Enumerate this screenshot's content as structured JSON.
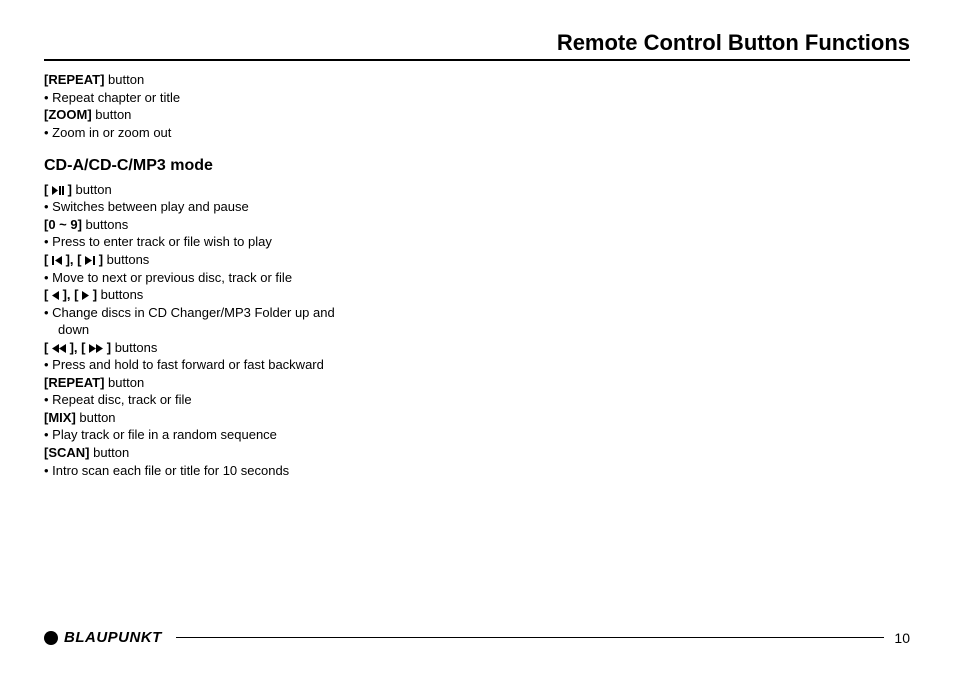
{
  "page_title": "Remote Control Button Functions",
  "top_items": [
    {
      "label_pre": "[",
      "label_main": "REPEAT",
      "label_post": "]",
      "suffix": " button",
      "bullets": [
        "Repeat chapter or title"
      ]
    },
    {
      "label_pre": "[",
      "label_main": "ZOOM",
      "label_post": "]",
      "suffix": " button",
      "bullets": [
        "Zoom in or zoom out"
      ]
    }
  ],
  "subheading": "CD-A/CD-C/MP3 mode",
  "mode_items": [
    {
      "type": "icons",
      "icon_set": "playpause",
      "suffix": " button",
      "bullets": [
        "Switches between play and pause"
      ]
    },
    {
      "type": "text",
      "label_pre": "",
      "label_main": "[0 ~ 9]",
      "label_post": "",
      "suffix": " buttons",
      "bullets": [
        "Press to enter track or file wish to play"
      ]
    },
    {
      "type": "icons",
      "icon_set": "prevnext",
      "suffix": " buttons",
      "bullets": [
        "Move to next or previous disc, track or file"
      ]
    },
    {
      "type": "icons",
      "icon_set": "leftright",
      "suffix": " buttons",
      "bullets": [
        "Change discs in CD Changer/MP3 Folder up and",
        "down"
      ],
      "continuation_from": 1
    },
    {
      "type": "icons",
      "icon_set": "rewff",
      "suffix": " buttons",
      "bullets": [
        "Press and hold to fast forward or fast backward"
      ]
    },
    {
      "type": "text",
      "label_pre": "[",
      "label_main": "REPEAT",
      "label_post": "]",
      "suffix": " button",
      "bullets": [
        "Repeat disc, track or file"
      ]
    },
    {
      "type": "text",
      "label_pre": "[",
      "label_main": "MIX",
      "label_post": "]",
      "suffix": " button",
      "bullets": [
        "Play track or file in a random sequence"
      ]
    },
    {
      "type": "text",
      "label_pre": "[",
      "label_main": "SCAN",
      "label_post": "]",
      "suffix": " button",
      "bullets": [
        "Intro scan each file or title for 10 seconds"
      ]
    }
  ],
  "brand": "BLAUPUNKT",
  "page_number": "10",
  "bracket_open": "[ ",
  "bracket_close": " ]",
  "comma_sep": ", "
}
